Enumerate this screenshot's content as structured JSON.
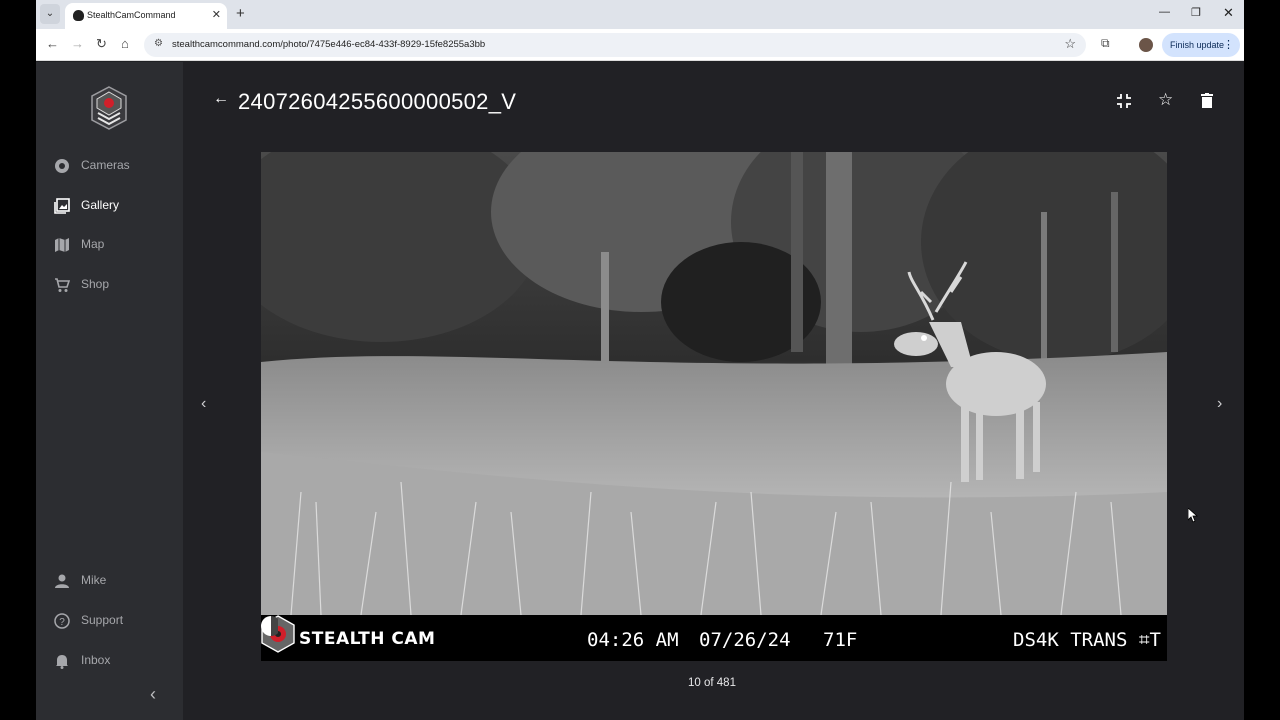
{
  "browser": {
    "tab_title": "StealthCamCommand",
    "url": "stealthcamcommand.com/photo/7475e446-ec84-433f-8929-15fe8255a3bb",
    "finish_update_label": "Finish update",
    "tab_close_glyph": "✕",
    "new_tab_glyph": "+",
    "icons": [
      "tab-dropdown-icon",
      "back-icon",
      "forward-icon",
      "reload-icon",
      "home-icon",
      "site-settings-icon",
      "bookmark-star-icon",
      "extensions-icon",
      "profile-avatar",
      "menu-dots-icon",
      "minimize-icon",
      "maximize-icon",
      "close-icon"
    ]
  },
  "sidebar": {
    "items": [
      {
        "label": "Cameras",
        "icon": "aperture-icon",
        "active": false
      },
      {
        "label": "Gallery",
        "icon": "gallery-icon",
        "active": true
      },
      {
        "label": "Map",
        "icon": "map-icon",
        "active": false
      },
      {
        "label": "Shop",
        "icon": "cart-icon",
        "active": false
      }
    ],
    "bottom_items": [
      {
        "label": "Mike",
        "icon": "person-icon"
      },
      {
        "label": "Support",
        "icon": "help-icon"
      },
      {
        "label": "Inbox",
        "icon": "bell-icon"
      }
    ],
    "collapse_glyph": "‹"
  },
  "photo_view": {
    "title": "24072604255600000502_V",
    "actions": [
      "fullscreen-exit-icon",
      "favorite-star-icon",
      "delete-icon"
    ],
    "overlay": {
      "brand": "STEALTH CAM",
      "time": "04:26 AM",
      "date": "07/26/24",
      "temperature": "71F",
      "camera": "DS4K TRANS ⌗T"
    },
    "counter": "10 of 481"
  },
  "colors": {
    "background": "#212125",
    "sidebar": "#2c2d31",
    "text_active": "#ffffff",
    "text_inactive": "#a6a7ab",
    "brand_red": "#d11f2a"
  }
}
